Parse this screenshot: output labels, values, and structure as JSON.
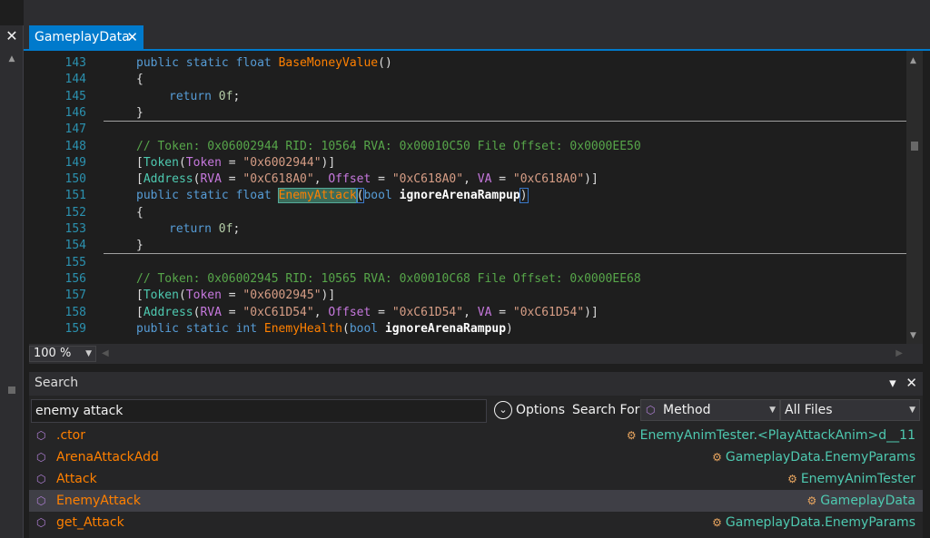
{
  "tab": {
    "label": "GameplayData",
    "close": "✕"
  },
  "left_close": "✕",
  "code_lines": [
    {
      "n": "143",
      "html": "<span class=\"kw\">public</span> <span class=\"kw\">static</span> <span class=\"ty\">float</span> <span class=\"mth\">BaseMoneyValue</span>()"
    },
    {
      "n": "144",
      "html": "{"
    },
    {
      "n": "145",
      "html": "    <span class=\"kw\">return</span> <span class=\"num\">0f</span>;"
    },
    {
      "n": "146",
      "html": "}",
      "sep": true
    },
    {
      "n": "147",
      "html": ""
    },
    {
      "n": "148",
      "html": "<span class=\"cm\">// Token: 0x06002944 RID: 10564 RVA: 0x00010C50 File Offset: 0x0000EE50</span>"
    },
    {
      "n": "149",
      "html": "[<span class=\"attr\">Token</span>(<span class=\"prop\">Token</span> = <span class=\"str\">\"0x6002944\"</span>)]"
    },
    {
      "n": "150",
      "html": "[<span class=\"attr\">Address</span>(<span class=\"prop\">RVA</span> = <span class=\"str\">\"0xC618A0\"</span>, <span class=\"prop\">Offset</span> = <span class=\"str\">\"0xC618A0\"</span>, <span class=\"prop\">VA</span> = <span class=\"str\">\"0xC618A0\"</span>)]"
    },
    {
      "n": "151",
      "html": "<span class=\"kw\">public</span> <span class=\"kw\">static</span> <span class=\"ty\">float</span> <span class=\"hl\">EnemyAttack</span><span class=\"bracket\">(</span><span class=\"ty\">bool</span> <span class=\"prm\">ignoreArenaRampup</span><span class=\"bracket\">)</span>"
    },
    {
      "n": "152",
      "html": "{"
    },
    {
      "n": "153",
      "html": "    <span class=\"kw\">return</span> <span class=\"num\">0f</span>;"
    },
    {
      "n": "154",
      "html": "}",
      "sep": true
    },
    {
      "n": "155",
      "html": ""
    },
    {
      "n": "156",
      "html": "<span class=\"cm\">// Token: 0x06002945 RID: 10565 RVA: 0x00010C68 File Offset: 0x0000EE68</span>"
    },
    {
      "n": "157",
      "html": "[<span class=\"attr\">Token</span>(<span class=\"prop\">Token</span> = <span class=\"str\">\"0x6002945\"</span>)]"
    },
    {
      "n": "158",
      "html": "[<span class=\"attr\">Address</span>(<span class=\"prop\">RVA</span> = <span class=\"str\">\"0xC61D54\"</span>, <span class=\"prop\">Offset</span> = <span class=\"str\">\"0xC61D54\"</span>, <span class=\"prop\">VA</span> = <span class=\"str\">\"0xC61D54\"</span>)]"
    },
    {
      "n": "159",
      "html": "<span class=\"kw\">public</span> <span class=\"kw\">static</span> <span class=\"ty\">int</span> <span class=\"mth\">EnemyHealth</span>(<span class=\"ty\">bool</span> <span class=\"prm\">ignoreArenaRampup</span>)"
    }
  ],
  "zoom": {
    "value": "100 %"
  },
  "search": {
    "title": "Search",
    "query": "enemy attack",
    "options_label": "Options",
    "search_for_label": "Search For:",
    "search_for_value": "Method",
    "scope_value": "All Files",
    "results": [
      {
        "name": ".ctor",
        "type": "EnemyAnimTester.<PlayAttackAnim>d__11",
        "selected": false
      },
      {
        "name": "ArenaAttackAdd",
        "type": "GameplayData.EnemyParams",
        "selected": false
      },
      {
        "name": "Attack",
        "type": "EnemyAnimTester",
        "selected": false
      },
      {
        "name": "EnemyAttack",
        "type": "GameplayData",
        "selected": true
      },
      {
        "name": "get_Attack",
        "type": "GameplayData.EnemyParams",
        "selected": false
      }
    ]
  },
  "colors": {
    "accent": "#007acc",
    "method": "#ff8000",
    "type": "#4ec9b0",
    "keyword": "#569cd6"
  }
}
